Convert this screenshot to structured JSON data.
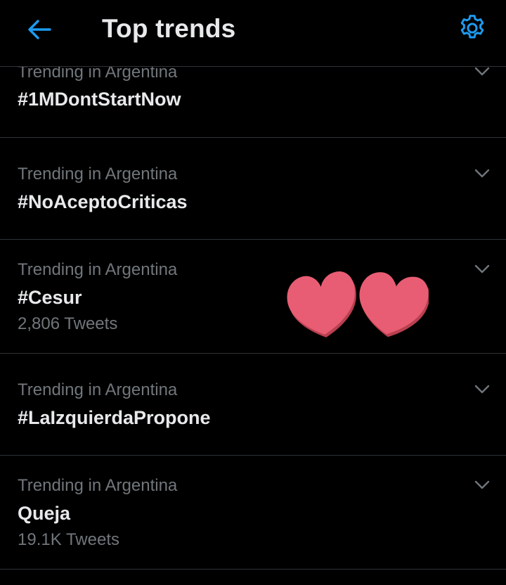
{
  "header": {
    "title": "Top trends",
    "back_icon": "arrow-left-icon",
    "settings_icon": "gear-icon",
    "accent_color": "#1d9bf0"
  },
  "trends": [
    {
      "context": "Trending in Argentina",
      "name": "#1MDontStartNow",
      "count": ""
    },
    {
      "context": "Trending in Argentina",
      "name": "#NoAceptoCriticas",
      "count": ""
    },
    {
      "context": "Trending in Argentina",
      "name": "#Cesur",
      "count": "2,806 Tweets"
    },
    {
      "context": "Trending in Argentina",
      "name": "#LaIzquierdaPropone",
      "count": ""
    },
    {
      "context": "Trending in Argentina",
      "name": "Queja",
      "count": "19.1K Tweets"
    }
  ],
  "overlay": {
    "icon": "two-hearts-sticker",
    "color": "#e85d73"
  }
}
